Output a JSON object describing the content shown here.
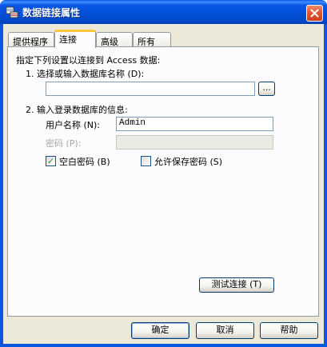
{
  "window": {
    "title": "数据链接属性",
    "icon": "data-link-icon",
    "close": "close-icon"
  },
  "tabs": [
    {
      "label": "提供程序",
      "active": false
    },
    {
      "label": "连接",
      "active": true
    },
    {
      "label": "高级",
      "active": false
    },
    {
      "label": "所有",
      "active": false
    }
  ],
  "connection": {
    "intro": "指定下列设置以连接到 Access 数据:",
    "step1_label": "1. 选择或输入数据库名称 (D):",
    "database_value": "",
    "browse_label": "...",
    "step2_label": "2. 输入登录数据库的信息:",
    "username_label": "用户名称 (N):",
    "username_value": "Admin",
    "password_label": "密码 (P):",
    "password_value": "",
    "blank_password_label": "空白密码 (B)",
    "blank_password_checked": true,
    "allow_save_label": "允许保存密码 (S)",
    "allow_save_checked": false,
    "test_button_label": "测试连接 (T)"
  },
  "footer": {
    "ok_label": "确定",
    "cancel_label": "取消",
    "help_label": "帮助"
  },
  "colors": {
    "title_bar": "#0a57e0",
    "dialog_bg": "#ece9d8",
    "active_tab_accent": "#ffc83c",
    "checkmark": "#21a121"
  }
}
